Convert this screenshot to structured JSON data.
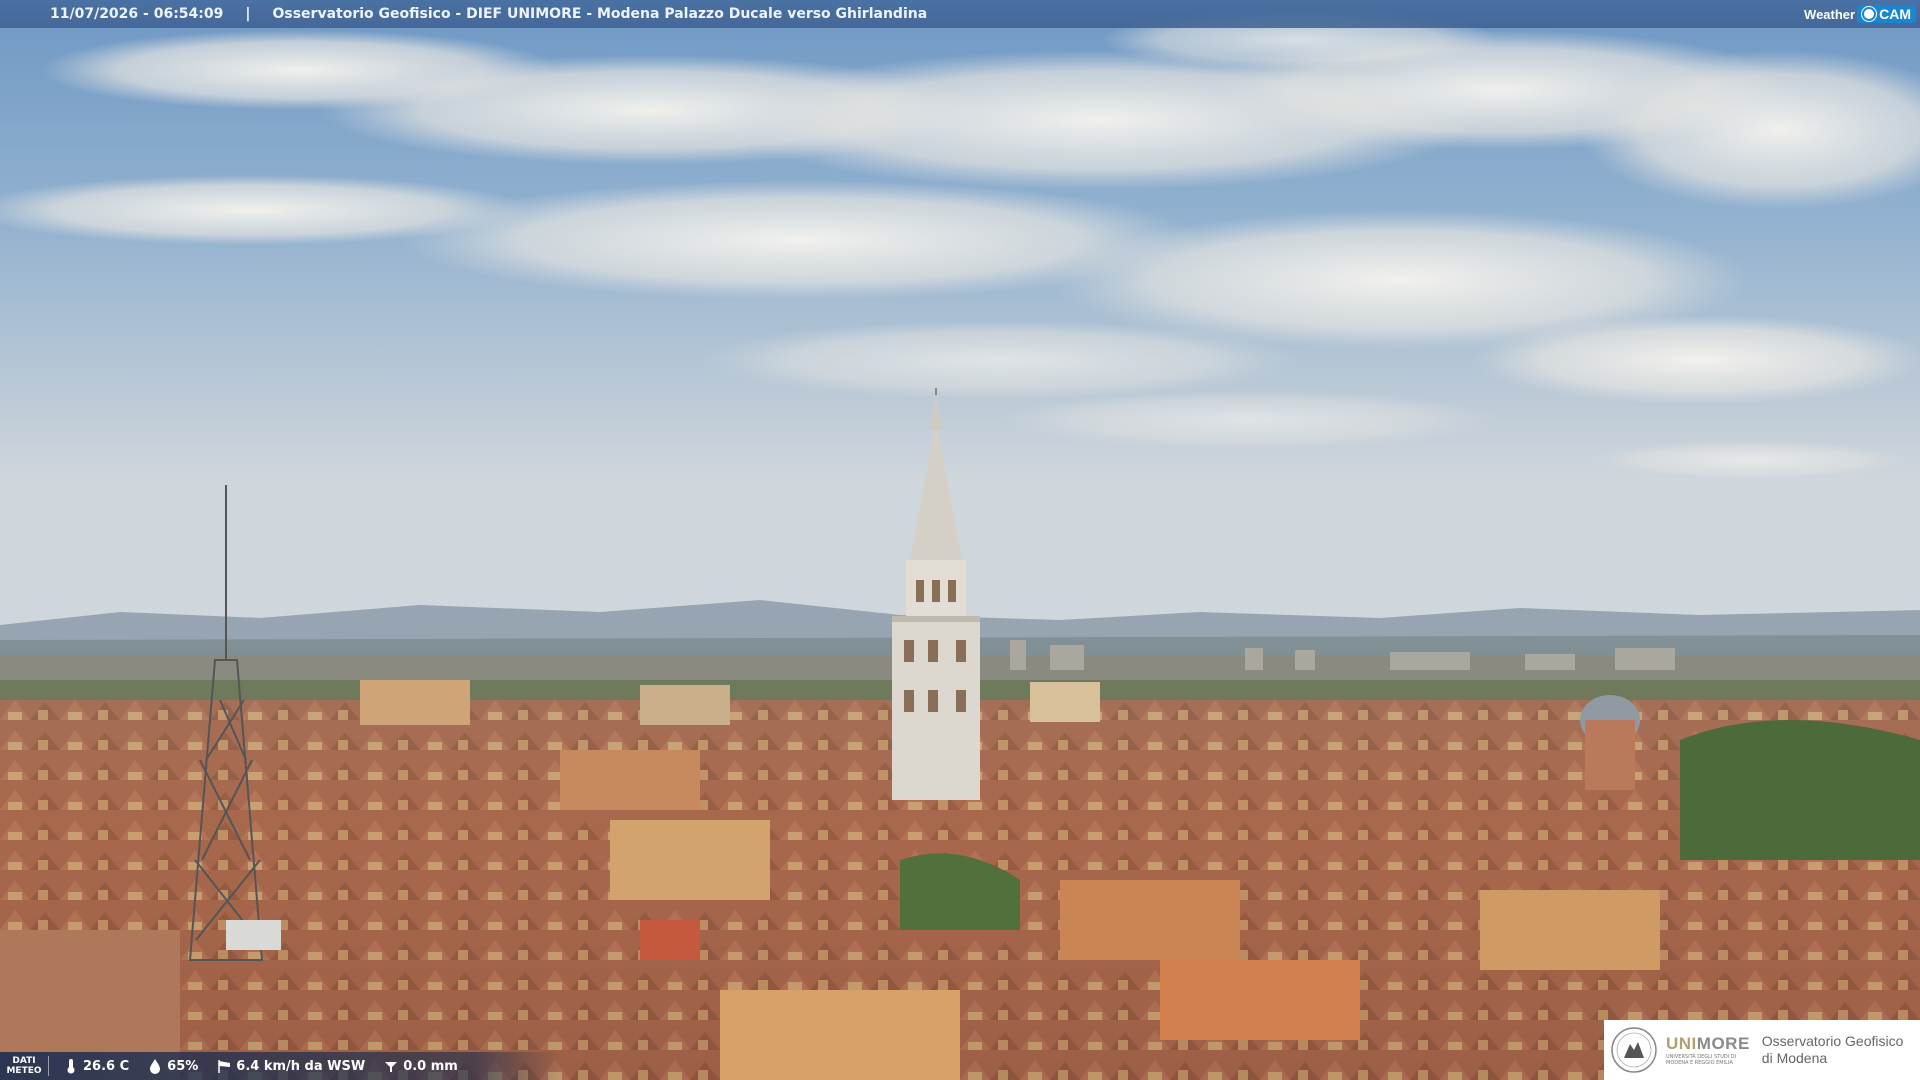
{
  "header": {
    "timestamp": "11/07/2026 - 06:54:09",
    "separator": "|",
    "title": "Osservatorio Geofisico - DIEF UNIMORE - Modena Palazzo Ducale verso Ghirlandina",
    "brand_weather": "Weather",
    "brand_cam": "CAM"
  },
  "weather": {
    "dati_label_1": "DATI",
    "dati_label_2": "METEO",
    "temperature": "26.6 C",
    "humidity": "65%",
    "wind": "6.4 km/h da WSW",
    "rain": "0.0 mm",
    "icons": [
      "thermometer-icon",
      "humidity-drop-icon",
      "wind-sock-icon",
      "rain-gauge-icon"
    ]
  },
  "logo": {
    "unimore_uni": "UNI",
    "unimore_more": "MORE",
    "unimore_sub_1": "UNIVERSITÀ DEGLI STUDI DI",
    "unimore_sub_2": "MODENA E REGGIO EMILIA",
    "observatory_line_1": "Osservatorio Geofisico",
    "observatory_line_2": "di Modena"
  },
  "colors": {
    "sky_top": "#7fa3c8",
    "sky_horizon": "#c9d4dc",
    "roof": "#a5634a",
    "tower": "#dcd8d0",
    "bar": "#3c6296",
    "brand_cam": "#1a86d0"
  }
}
